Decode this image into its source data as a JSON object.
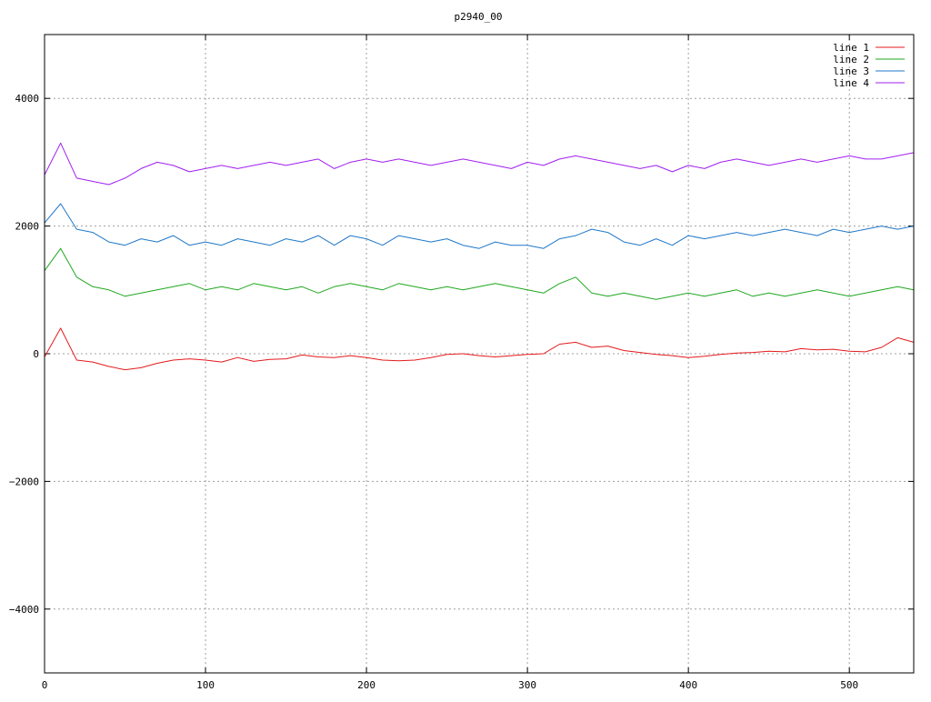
{
  "chart_data": {
    "type": "line",
    "title": "p2940_00",
    "xlabel": "",
    "ylabel": "",
    "xlim": [
      0,
      540
    ],
    "ylim": [
      -5000,
      5000
    ],
    "x_ticks": [
      0,
      100,
      200,
      300,
      400,
      500
    ],
    "y_ticks": [
      -4000,
      -2000,
      0,
      2000,
      4000
    ],
    "grid": true,
    "legend_position": "top-right",
    "x_step": 10,
    "series": [
      {
        "name": "line 1",
        "color": "#e41a1c",
        "values": [
          -50,
          400,
          -100,
          -130,
          -200,
          -250,
          -220,
          -150,
          -100,
          -80,
          -100,
          -130,
          -60,
          -120,
          -90,
          -80,
          -20,
          -50,
          -60,
          -30,
          -60,
          -100,
          -110,
          -100,
          -60,
          -10,
          0,
          -30,
          -50,
          -30,
          -10,
          0,
          150,
          180,
          100,
          120,
          50,
          20,
          -10,
          -30,
          -60,
          -40,
          -10,
          10,
          20,
          40,
          30,
          80,
          60,
          70,
          40,
          30,
          100,
          250,
          180,
          100,
          20,
          60,
          80,
          100,
          80,
          130,
          150,
          180,
          100,
          50,
          -80,
          -150,
          -100,
          -80,
          0,
          100,
          180,
          120,
          90,
          -200,
          -250,
          -100,
          -80,
          -60,
          0,
          -30,
          -200,
          -50,
          -40,
          0,
          50,
          80,
          100,
          60,
          90,
          30,
          40,
          100,
          200,
          230,
          150,
          100,
          100,
          90,
          80,
          120,
          150,
          180,
          150,
          200,
          50,
          150,
          300,
          500
        ]
      },
      {
        "name": "line 2",
        "color": "#1fa81f",
        "values": [
          1300,
          1650,
          1200,
          1050,
          1000,
          900,
          950,
          1000,
          1050,
          1100,
          1000,
          1050,
          1000,
          1100,
          1050,
          1000,
          1050,
          950,
          1050,
          1100,
          1050,
          1000,
          1100,
          1050,
          1000,
          1050,
          1000,
          1050,
          1100,
          1050,
          1000,
          950,
          1100,
          1200,
          950,
          900,
          950,
          900,
          850,
          900,
          950,
          900,
          950,
          1000,
          900,
          950,
          900,
          950,
          1000,
          950,
          900,
          950,
          1000,
          1050,
          1000,
          950,
          1000,
          1000,
          1050,
          1000,
          1050,
          1050,
          1100,
          1050,
          1000,
          950,
          850,
          900,
          950,
          850,
          1000,
          1050,
          1000,
          1050,
          1000,
          950,
          1000,
          1050,
          1000,
          1000,
          950,
          850,
          900,
          1000,
          1050,
          950,
          800,
          900,
          1000,
          1150,
          1100,
          1000,
          1100,
          1050,
          1100,
          1050,
          1050,
          1100,
          1050,
          1000,
          1000,
          1100,
          950,
          1100,
          1000,
          1050,
          800,
          950,
          1000,
          1100,
          1300
        ]
      },
      {
        "name": "line 3",
        "color": "#1f78c8",
        "values": [
          2050,
          2350,
          1950,
          1900,
          1750,
          1700,
          1800,
          1750,
          1850,
          1700,
          1750,
          1700,
          1800,
          1750,
          1700,
          1800,
          1750,
          1850,
          1700,
          1850,
          1800,
          1700,
          1850,
          1800,
          1750,
          1800,
          1700,
          1650,
          1750,
          1700,
          1700,
          1650,
          1800,
          1850,
          1950,
          1900,
          1750,
          1700,
          1800,
          1700,
          1850,
          1800,
          1850,
          1900,
          1850,
          1900,
          1950,
          1900,
          1850,
          1950,
          1900,
          1950,
          2000,
          1950,
          2000,
          2100,
          2050,
          2000,
          2050,
          2100,
          2050,
          2100,
          2100,
          2050,
          2000,
          2050,
          2100,
          2000,
          2050,
          1900,
          1900,
          2000,
          1950,
          2000,
          2050,
          1950,
          2000,
          2050,
          1950,
          2000,
          2050,
          1950,
          1900,
          2000,
          2100,
          2050,
          2200,
          2100,
          2050,
          2150,
          2050,
          2150,
          2300,
          2250,
          2400,
          2500,
          2450,
          2550,
          2400,
          2500,
          2450,
          2400,
          2550,
          2500,
          2450,
          2500,
          2600,
          2450,
          2700,
          2600,
          2800
        ]
      },
      {
        "name": "line 4",
        "color": "#a020f0",
        "values": [
          2800,
          3300,
          2750,
          2700,
          2650,
          2750,
          2900,
          3000,
          2950,
          2850,
          2900,
          2950,
          2900,
          2950,
          3000,
          2950,
          3000,
          3050,
          2900,
          3000,
          3050,
          3000,
          3050,
          3000,
          2950,
          3000,
          3050,
          3000,
          2950,
          2900,
          3000,
          2950,
          3050,
          3100,
          3050,
          3000,
          2950,
          2900,
          2950,
          2850,
          2950,
          2900,
          3000,
          3050,
          3000,
          2950,
          3000,
          3050,
          3000,
          3050,
          3100,
          3050,
          3050,
          3100,
          3150,
          3150,
          3100,
          3100,
          3150,
          3100,
          3050,
          3150,
          3100,
          3050,
          3000,
          2950,
          2900,
          3000,
          3100,
          3050,
          3000,
          3050,
          3000,
          3100,
          3050,
          3100,
          3000,
          3050,
          2950,
          3050,
          3100,
          3000,
          2900,
          2950,
          3000,
          3050,
          3000,
          3200,
          3100,
          3000,
          2950,
          2900,
          3000,
          2950,
          3000,
          3050,
          3100,
          3000,
          3050,
          3000,
          2950,
          3050,
          2900,
          2950,
          3050,
          3100,
          2950,
          3100,
          3000,
          2950,
          3300
        ]
      }
    ]
  }
}
